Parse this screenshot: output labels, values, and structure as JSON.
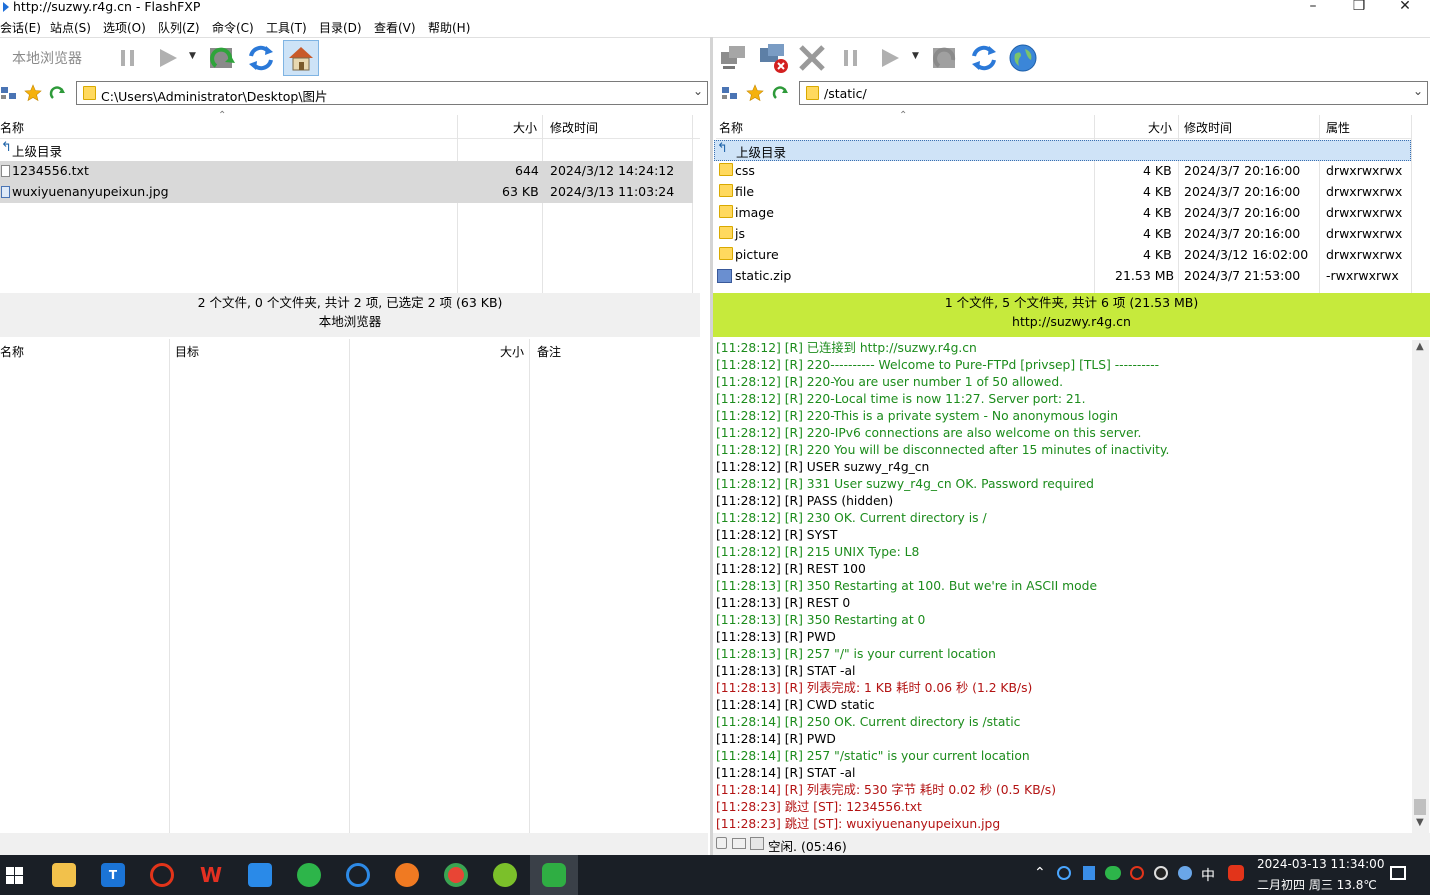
{
  "window": {
    "title": "http://suzwy.r4g.cn - FlashFXP"
  },
  "menu": [
    "会话(E)",
    "站点(S)",
    "选项(O)",
    "队列(Z)",
    "命令(C)",
    "工具(T)",
    "目录(D)",
    "查看(V)",
    "帮助(H)"
  ],
  "local": {
    "toolbar_label": "本地浏览器",
    "path": "C:\\Users\\Administrator\\Desktop\\图片",
    "columns": {
      "name": "名称",
      "size": "大小",
      "modified": "修改时间"
    },
    "parent": "上级目录",
    "files": [
      {
        "name": "1234556.txt",
        "size": "644",
        "modified": "2024/3/12 14:24:12"
      },
      {
        "name": "wuxiyuenanyupeixun.jpg",
        "size": "63 KB",
        "modified": "2024/3/13 11:03:24"
      }
    ],
    "status_line1": "2 个文件, 0 个文件夹, 共计 2 项, 已选定 2 项 (63 KB)",
    "status_line2": "本地浏览器"
  },
  "remote": {
    "path": "/static/",
    "columns": {
      "name": "名称",
      "size": "大小",
      "modified": "修改时间",
      "attrs": "属性"
    },
    "parent": "上级目录",
    "files": [
      {
        "name": "css",
        "size": "4 KB",
        "modified": "2024/3/7 20:16:00",
        "attrs": "drwxrwxrwx",
        "type": "folder"
      },
      {
        "name": "file",
        "size": "4 KB",
        "modified": "2024/3/7 20:16:00",
        "attrs": "drwxrwxrwx",
        "type": "folder"
      },
      {
        "name": "image",
        "size": "4 KB",
        "modified": "2024/3/7 20:16:00",
        "attrs": "drwxrwxrwx",
        "type": "folder"
      },
      {
        "name": "js",
        "size": "4 KB",
        "modified": "2024/3/7 20:16:00",
        "attrs": "drwxrwxrwx",
        "type": "folder"
      },
      {
        "name": "picture",
        "size": "4 KB",
        "modified": "2024/3/12 16:02:00",
        "attrs": "drwxrwxrwx",
        "type": "folder"
      },
      {
        "name": "static.zip",
        "size": "21.53 MB",
        "modified": "2024/3/7 21:53:00",
        "attrs": "-rwxrwxrwx",
        "type": "zip"
      }
    ],
    "status_line1": "1 个文件, 5 个文件夹, 共计 6 项 (21.53 MB)",
    "status_line2": "http://suzwy.r4g.cn",
    "status_color": "#c6ea3c"
  },
  "queue": {
    "columns": {
      "name": "名称",
      "target": "目标",
      "size": "大小",
      "note": "备注"
    }
  },
  "log": [
    {
      "t": "[11:28:12]",
      "msg": "[R] 已连接到 http://suzwy.r4g.cn",
      "c": "g"
    },
    {
      "t": "[11:28:12]",
      "msg": "[R] 220---------- Welcome to Pure-FTPd [privsep] [TLS] ----------",
      "c": "g"
    },
    {
      "t": "[11:28:12]",
      "msg": "[R] 220-You are user number 1 of 50 allowed.",
      "c": "g"
    },
    {
      "t": "[11:28:12]",
      "msg": "[R] 220-Local time is now 11:27. Server port: 21.",
      "c": "g"
    },
    {
      "t": "[11:28:12]",
      "msg": "[R] 220-This is a private system - No anonymous login",
      "c": "g"
    },
    {
      "t": "[11:28:12]",
      "msg": "[R] 220-IPv6 connections are also welcome on this server.",
      "c": "g"
    },
    {
      "t": "[11:28:12]",
      "msg": "[R] 220 You will be disconnected after 15 minutes of inactivity.",
      "c": "g"
    },
    {
      "t": "[11:28:12]",
      "msg": "[R] USER suzwy_r4g_cn",
      "c": "b"
    },
    {
      "t": "[11:28:12]",
      "msg": "[R] 331 User suzwy_r4g_cn OK. Password required",
      "c": "g"
    },
    {
      "t": "[11:28:12]",
      "msg": "[R] PASS (hidden)",
      "c": "b"
    },
    {
      "t": "[11:28:12]",
      "msg": "[R] 230 OK. Current directory is /",
      "c": "g"
    },
    {
      "t": "[11:28:12]",
      "msg": "[R] SYST",
      "c": "b"
    },
    {
      "t": "[11:28:12]",
      "msg": "[R] 215 UNIX Type: L8",
      "c": "g"
    },
    {
      "t": "[11:28:12]",
      "msg": "[R] REST 100",
      "c": "b"
    },
    {
      "t": "[11:28:13]",
      "msg": "[R] 350 Restarting at 100. But we're in ASCII mode",
      "c": "g"
    },
    {
      "t": "[11:28:13]",
      "msg": "[R] REST 0",
      "c": "b"
    },
    {
      "t": "[11:28:13]",
      "msg": "[R] 350 Restarting at 0",
      "c": "g"
    },
    {
      "t": "[11:28:13]",
      "msg": "[R] PWD",
      "c": "b"
    },
    {
      "t": "[11:28:13]",
      "msg": "[R] 257 \"/\" is your current location",
      "c": "g"
    },
    {
      "t": "[11:28:13]",
      "msg": "[R] STAT -al",
      "c": "b"
    },
    {
      "t": "[11:28:13]",
      "msg": "[R] 列表完成: 1 KB 耗时 0.06 秒 (1.2 KB/s)",
      "c": "r"
    },
    {
      "t": "[11:28:14]",
      "msg": "[R] CWD static",
      "c": "b"
    },
    {
      "t": "[11:28:14]",
      "msg": "[R] 250 OK. Current directory is /static",
      "c": "g"
    },
    {
      "t": "[11:28:14]",
      "msg": "[R] PWD",
      "c": "b"
    },
    {
      "t": "[11:28:14]",
      "msg": "[R] 257 \"/static\" is your current location",
      "c": "g"
    },
    {
      "t": "[11:28:14]",
      "msg": "[R] STAT -al",
      "c": "b"
    },
    {
      "t": "[11:28:14]",
      "msg": "[R] 列表完成: 530 字节 耗时 0.02 秒 (0.5 KB/s)",
      "c": "r"
    },
    {
      "t": "[11:28:23]",
      "msg": "跳过 [ST]: 1234556.txt",
      "c": "r"
    },
    {
      "t": "[11:28:23]",
      "msg": "跳过 [ST]: wuxiyuenanyupeixun.jpg",
      "c": "r"
    }
  ],
  "bottom_status": "空闲. (05:46)",
  "taskbar": {
    "ime": "中",
    "datetime": "2024-03-13 11:34:00",
    "date2": "二月初四 周三 13.8℃"
  }
}
